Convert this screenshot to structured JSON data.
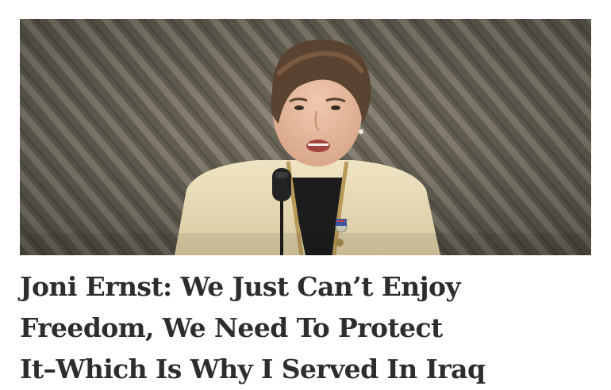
{
  "article": {
    "image": {
      "subject": "speaker-at-podium-photo"
    },
    "headline_lines": [
      "Joni Ernst: We Just Can’t Enjoy",
      "Freedom, We Need To Protect",
      "It–Which Is Why I Served In Iraq"
    ]
  },
  "colors": {
    "headline_text": "#2d2d2d",
    "background": "#ffffff",
    "backdrop": "#6f6a5c",
    "jacket": "#e6d9b4"
  }
}
